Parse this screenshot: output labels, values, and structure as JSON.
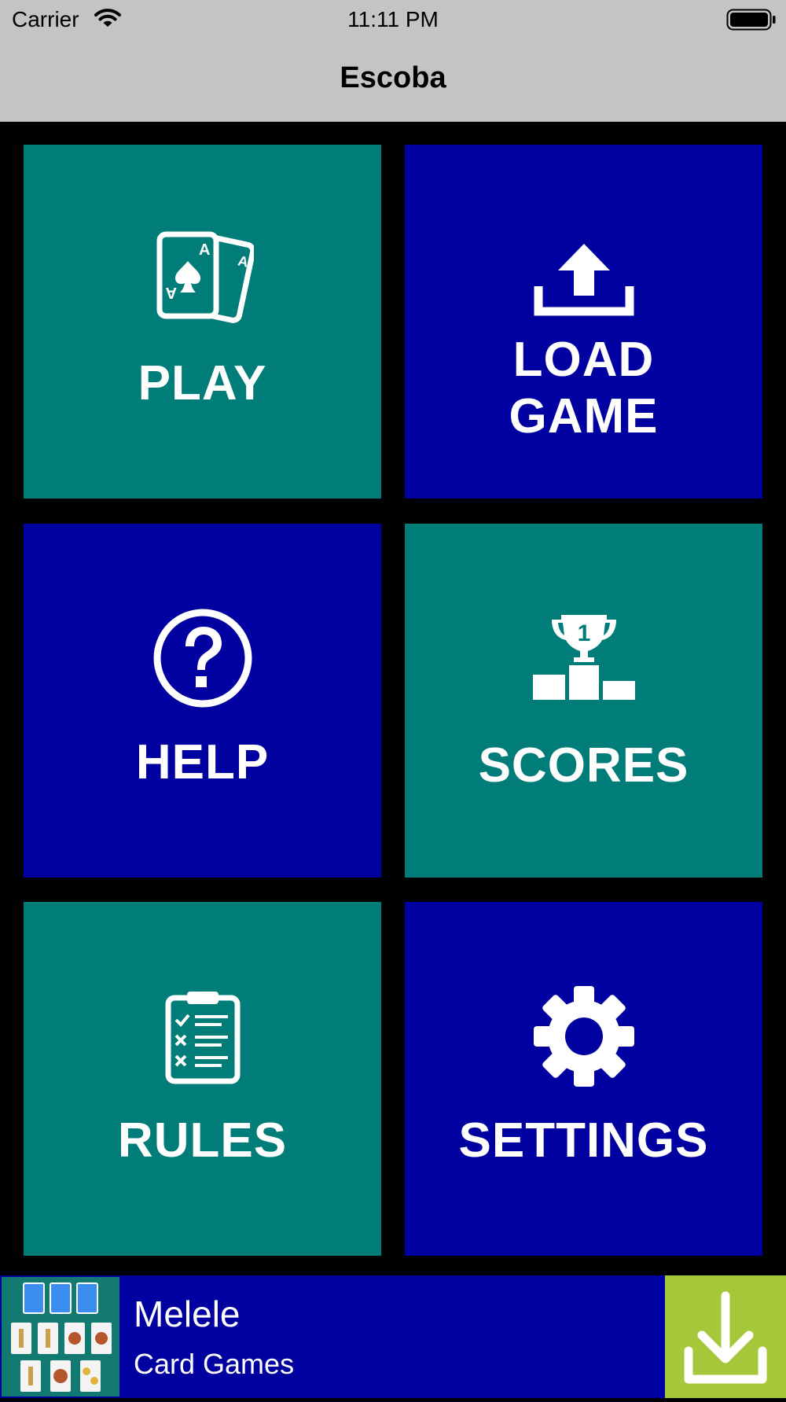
{
  "status_bar": {
    "carrier": "Carrier",
    "time": "11:11 PM"
  },
  "nav": {
    "title": "Escoba"
  },
  "menu": {
    "play": {
      "label": "PLAY",
      "icon": "playing-cards-icon",
      "color": "#007d78"
    },
    "load_game": {
      "line1": "LOAD",
      "line2": "GAME",
      "icon": "upload-icon",
      "color": "#0000a0"
    },
    "help": {
      "label": "HELP",
      "icon": "question-circle-icon",
      "color": "#0000a0"
    },
    "scores": {
      "label": "SCORES",
      "icon": "trophy-podium-icon",
      "trophy_number": "1",
      "color": "#007d78"
    },
    "rules": {
      "label": "RULES",
      "icon": "clipboard-checklist-icon",
      "color": "#007d78"
    },
    "settings": {
      "label": "SETTINGS",
      "icon": "gear-icon",
      "color": "#0000a0"
    }
  },
  "ad_banner": {
    "title": "Melele",
    "subtitle": "Card Games",
    "icon": "download-icon",
    "button_color": "#a5c73a"
  }
}
